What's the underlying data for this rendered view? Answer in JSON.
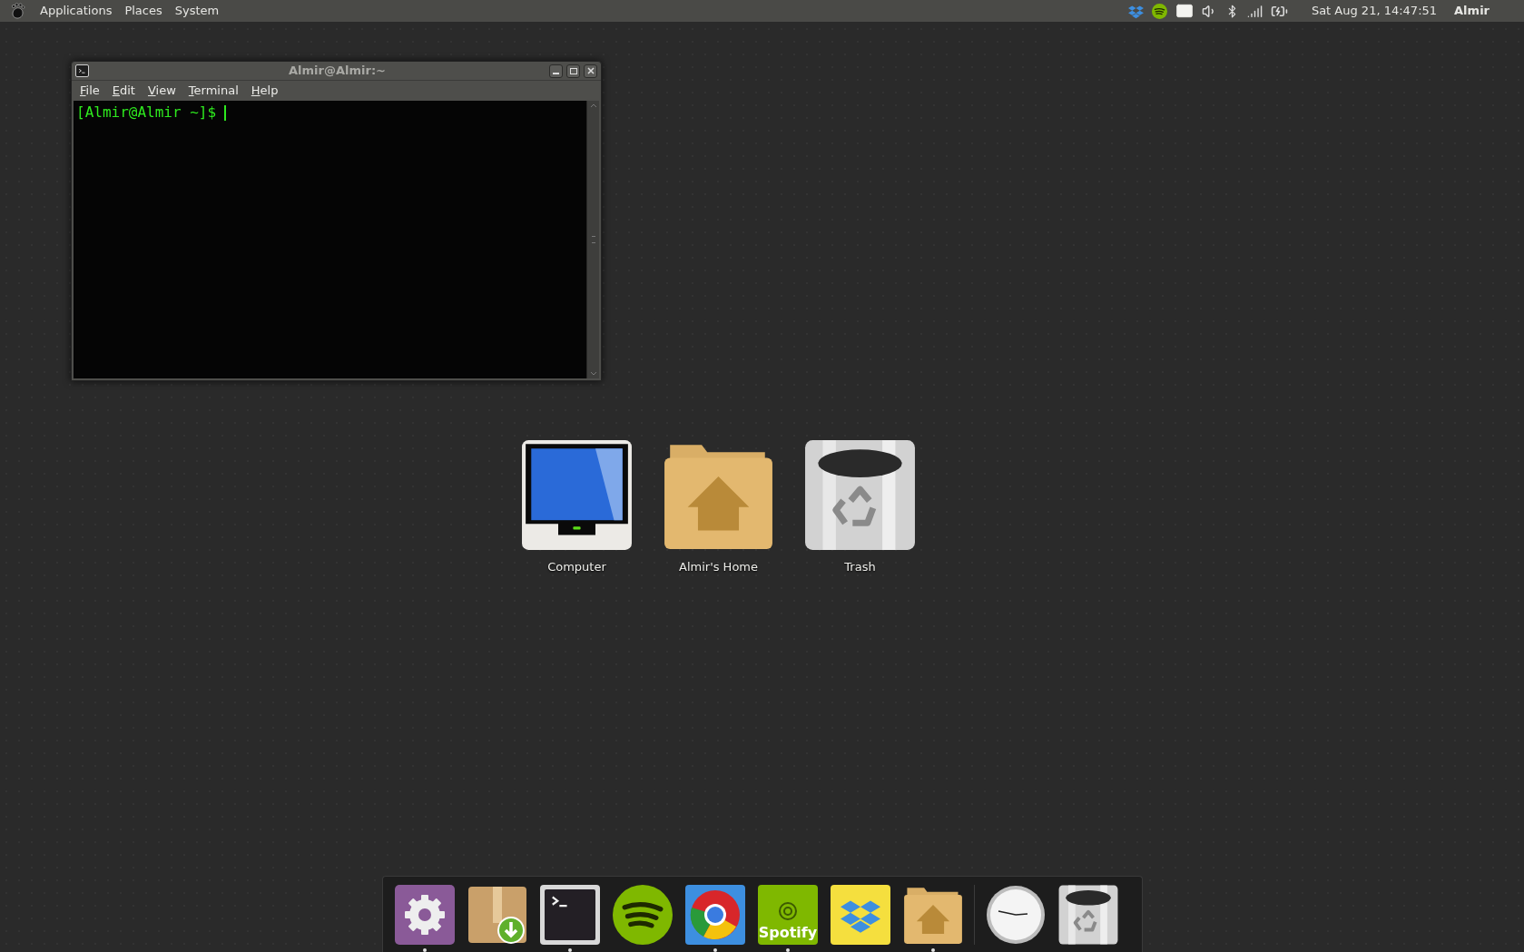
{
  "top_panel": {
    "menus": [
      "Applications",
      "Places",
      "System"
    ],
    "clock": "Sat Aug 21, 14:47:51",
    "user": "Almir"
  },
  "terminal_window": {
    "title": "Almir@Almir:~",
    "menus": [
      "File",
      "Edit",
      "View",
      "Terminal",
      "Help"
    ],
    "prompt": "[Almir@Almir ~]$"
  },
  "desktop_icons": [
    {
      "kind": "computer",
      "label": "Computer"
    },
    {
      "kind": "home",
      "label": "Almir's Home"
    },
    {
      "kind": "trash",
      "label": "Trash"
    }
  ],
  "dock": {
    "launchers": [
      {
        "kind": "settings",
        "running": true
      },
      {
        "kind": "package",
        "running": false
      },
      {
        "kind": "terminal",
        "running": true
      },
      {
        "kind": "music",
        "running": false
      },
      {
        "kind": "browser",
        "running": true
      },
      {
        "kind": "music-label",
        "label": "Spotify",
        "running": true
      },
      {
        "kind": "dropbox",
        "running": false
      },
      {
        "kind": "home",
        "running": true
      }
    ],
    "applets": [
      {
        "kind": "clock",
        "running": false
      },
      {
        "kind": "trash",
        "running": false
      }
    ]
  }
}
